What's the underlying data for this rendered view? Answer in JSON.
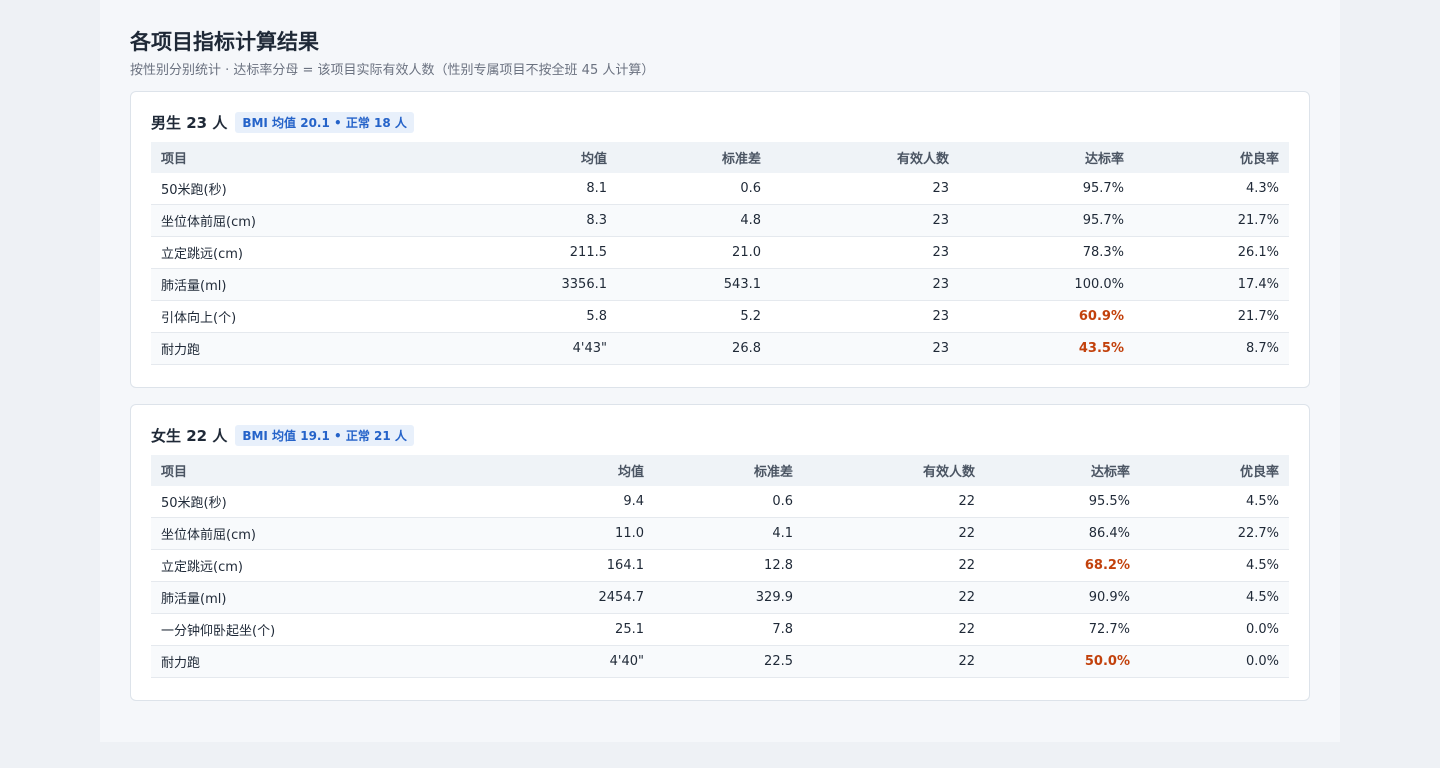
{
  "page": {
    "title": "各项目指标计算结果",
    "subtitle": "按性别分别统计 · 达标率分母 = 该项目实际有效人数（性别专属项目不按全班 45 人计算）"
  },
  "columns": [
    "项目",
    "均值",
    "标准差",
    "有效人数",
    "达标率",
    "优良率"
  ],
  "colors": {
    "warn": "#c2410c",
    "badge_text": "#2563c9",
    "badge_bg": "#e8f0fb"
  },
  "boys": {
    "title": "男生 23 人",
    "badge": "BMI 均值 20.1 • 正常 18 人",
    "rows": [
      {
        "name": "50米跑(秒)",
        "mean": "8.1",
        "sd": "0.6",
        "n": "23",
        "pass": "95.7%",
        "good": "4.3%",
        "warn": false
      },
      {
        "name": "坐位体前屈(cm)",
        "mean": "8.3",
        "sd": "4.8",
        "n": "23",
        "pass": "95.7%",
        "good": "21.7%",
        "warn": false
      },
      {
        "name": "立定跳远(cm)",
        "mean": "211.5",
        "sd": "21.0",
        "n": "23",
        "pass": "78.3%",
        "good": "26.1%",
        "warn": false
      },
      {
        "name": "肺活量(ml)",
        "mean": "3356.1",
        "sd": "543.1",
        "n": "23",
        "pass": "100.0%",
        "good": "17.4%",
        "warn": false
      },
      {
        "name": "引体向上(个)",
        "mean": "5.8",
        "sd": "5.2",
        "n": "23",
        "pass": "60.9%",
        "good": "21.7%",
        "warn": true
      },
      {
        "name": "耐力跑",
        "mean": "4'43\"",
        "sd": "26.8",
        "n": "23",
        "pass": "43.5%",
        "good": "8.7%",
        "warn": true
      }
    ]
  },
  "girls": {
    "title": "女生 22 人",
    "badge": "BMI 均值 19.1 • 正常 21 人",
    "rows": [
      {
        "name": "50米跑(秒)",
        "mean": "9.4",
        "sd": "0.6",
        "n": "22",
        "pass": "95.5%",
        "good": "4.5%",
        "warn": false
      },
      {
        "name": "坐位体前屈(cm)",
        "mean": "11.0",
        "sd": "4.1",
        "n": "22",
        "pass": "86.4%",
        "good": "22.7%",
        "warn": false
      },
      {
        "name": "立定跳远(cm)",
        "mean": "164.1",
        "sd": "12.8",
        "n": "22",
        "pass": "68.2%",
        "good": "4.5%",
        "warn": true
      },
      {
        "name": "肺活量(ml)",
        "mean": "2454.7",
        "sd": "329.9",
        "n": "22",
        "pass": "90.9%",
        "good": "4.5%",
        "warn": false
      },
      {
        "name": "一分钟仰卧起坐(个)",
        "mean": "25.1",
        "sd": "7.8",
        "n": "22",
        "pass": "72.7%",
        "good": "0.0%",
        "warn": false
      },
      {
        "name": "耐力跑",
        "mean": "4'40\"",
        "sd": "22.5",
        "n": "22",
        "pass": "50.0%",
        "good": "0.0%",
        "warn": true
      }
    ]
  }
}
